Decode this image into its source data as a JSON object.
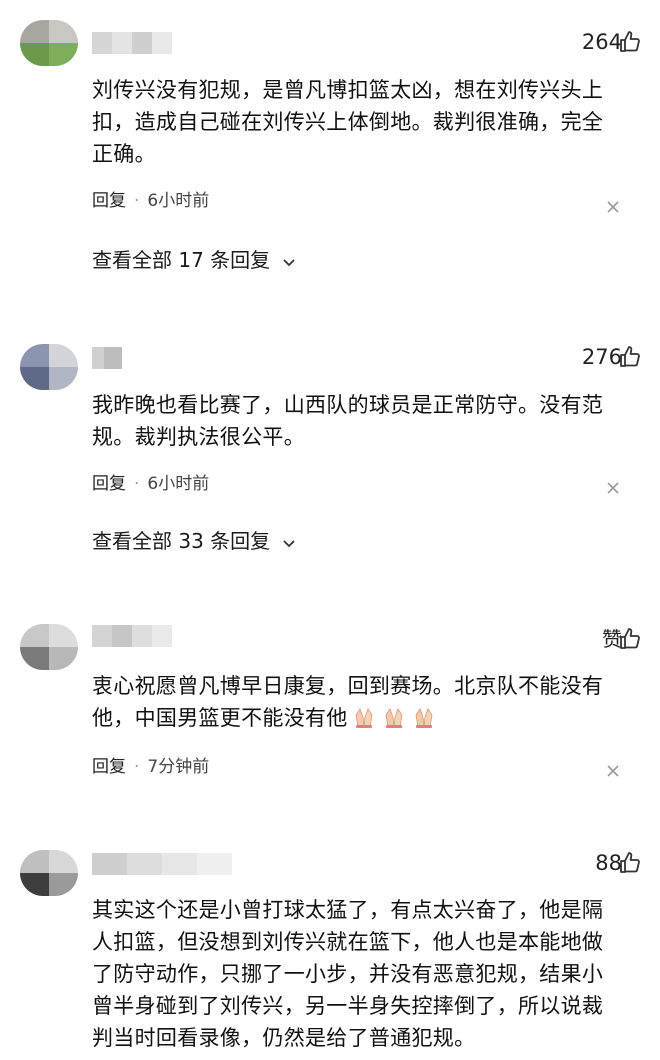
{
  "comments": [
    {
      "likes": "264",
      "text": "刘传兴没有犯规，是曾凡博扣篮太凶，想在刘传兴头上扣，造成自己碰在刘传兴上体倒地。裁判很准确，完全正确。",
      "reply_label": "回复",
      "separator": "·",
      "time": "6小时前",
      "view_replies": "查看全部 17 条回复"
    },
    {
      "likes": "276",
      "text": "我昨晚也看比赛了，山西队的球员是正常防守。没有范规。裁判执法很公平。",
      "reply_label": "回复",
      "separator": "·",
      "time": "6小时前",
      "view_replies": "查看全部 33 条回复"
    },
    {
      "likes": "赞",
      "text": "衷心祝愿曾凡博早日康复，回到赛场。北京队不能没有他，中国男篮更不能没有他",
      "reply_label": "回复",
      "separator": "·",
      "time": "7分钟前"
    },
    {
      "likes": "88",
      "text": "其实这个还是小曾打球太猛了，有点太兴奋了，他是隔人扣篮，但没想到刘传兴就在篮下，他人也是本能地做了防守动作，只挪了一小步，并没有恶意犯规，结果小曾半身碰到了刘传兴，另一半身失控摔倒了，所以说裁判当时回看录像，仍然是给了普通犯规。"
    }
  ],
  "icons": {
    "like": "thumbs-up-icon",
    "close": "close-icon",
    "expand": "chevron-down-icon",
    "emoji": "folded-hands-emoji"
  }
}
